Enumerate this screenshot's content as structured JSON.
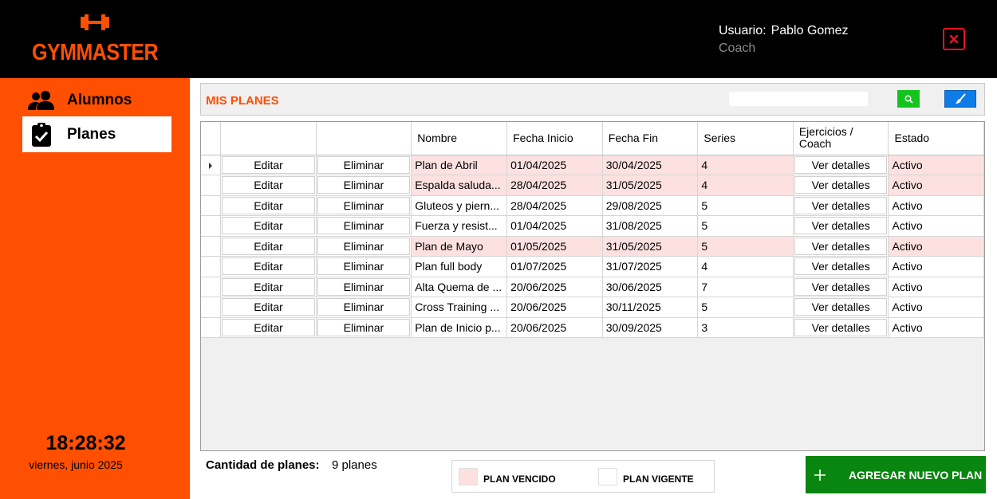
{
  "app": {
    "brand": "GYMMASTER",
    "colors": {
      "brand": "#ff4f00",
      "header_bg": "#000000",
      "expired_row": "#fde1e1",
      "add_button": "#08860f",
      "search_button": "#14c41e",
      "clear_button": "#0e7ce8",
      "close_icon": "#e81123"
    }
  },
  "header": {
    "user_label": "Usuario:",
    "user_name": "Pablo Gomez",
    "user_role": "Coach",
    "close_icon": "close-icon"
  },
  "sidebar": {
    "items": [
      {
        "label": "Alumnos",
        "icon": "users-icon",
        "active": false
      },
      {
        "label": "Planes",
        "icon": "clipboard-check-icon",
        "active": true
      }
    ],
    "clock": "18:28:32",
    "date": "viernes, junio 2025"
  },
  "main": {
    "title": "MIS PLANES",
    "search": {
      "value": "",
      "placeholder": "",
      "icon": "search-icon",
      "clear_icon": "brush-icon"
    },
    "table": {
      "columns": [
        "",
        "",
        "Nombre",
        "Fecha Inicio",
        "Fecha Fin",
        "Series",
        "Ejercicios / Coach",
        "Estado"
      ],
      "edit_label": "Editar",
      "delete_label": "Eliminar",
      "details_label": "Ver detalles",
      "rows": [
        {
          "nombre": "Plan de Abril",
          "inicio": "01/04/2025",
          "fin": "30/04/2025",
          "series": "4",
          "estado": "Activo",
          "vencido": true
        },
        {
          "nombre": "Espalda saluda...",
          "inicio": "28/04/2025",
          "fin": "31/05/2025",
          "series": "4",
          "estado": "Activo",
          "vencido": true
        },
        {
          "nombre": "Gluteos y piern...",
          "inicio": "28/04/2025",
          "fin": "29/08/2025",
          "series": "5",
          "estado": "Activo",
          "vencido": false
        },
        {
          "nombre": "Fuerza y resist...",
          "inicio": "01/04/2025",
          "fin": "31/08/2025",
          "series": "5",
          "estado": "Activo",
          "vencido": false
        },
        {
          "nombre": "Plan de Mayo",
          "inicio": "01/05/2025",
          "fin": "31/05/2025",
          "series": "5",
          "estado": "Activo",
          "vencido": true
        },
        {
          "nombre": "Plan full body",
          "inicio": "01/07/2025",
          "fin": "31/07/2025",
          "series": "4",
          "estado": "Activo",
          "vencido": false
        },
        {
          "nombre": "Alta Quema de ...",
          "inicio": "20/06/2025",
          "fin": "30/06/2025",
          "series": "7",
          "estado": "Activo",
          "vencido": false
        },
        {
          "nombre": "Cross Training ...",
          "inicio": "20/06/2025",
          "fin": "30/11/2025",
          "series": "5",
          "estado": "Activo",
          "vencido": false
        },
        {
          "nombre": "Plan de Inicio p...",
          "inicio": "20/06/2025",
          "fin": "30/09/2025",
          "series": "3",
          "estado": "Activo",
          "vencido": false
        }
      ]
    }
  },
  "footer": {
    "count_label": "Cantidad de planes:",
    "count_value": "9 planes",
    "legend": [
      {
        "label": "PLAN VENCIDO",
        "color": "#fde1e1"
      },
      {
        "label": "PLAN VIGENTE",
        "color": "#ffffff"
      }
    ],
    "add_button": "AGREGAR NUEVO PLAN",
    "add_icon": "plus-icon"
  }
}
